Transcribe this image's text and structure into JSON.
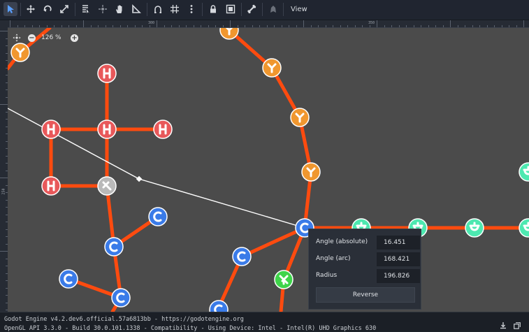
{
  "toolbar": {
    "tools": [
      {
        "name": "select-tool",
        "icon": "arrow-cursor-icon",
        "active": true
      },
      {
        "name": "move-tool",
        "icon": "move-arrows-icon"
      },
      {
        "name": "rotate-tool",
        "icon": "rotate-icon"
      },
      {
        "name": "scale-tool",
        "icon": "scale-icon"
      },
      {
        "name": "list-select-tool",
        "icon": "list-select-icon"
      },
      {
        "name": "pivot-tool",
        "icon": "pivot-icon"
      },
      {
        "name": "pan-tool",
        "icon": "hand-icon"
      },
      {
        "name": "ruler-tool",
        "icon": "ruler-icon"
      },
      {
        "name": "smart-snap-tool",
        "icon": "snap-icon"
      },
      {
        "name": "grid-snap-tool",
        "icon": "grid-snap-icon"
      },
      {
        "name": "snap-options",
        "icon": "kebab-icon"
      },
      {
        "name": "lock-tool",
        "icon": "lock-icon"
      },
      {
        "name": "group-tool",
        "icon": "group-icon"
      },
      {
        "name": "bone-tool",
        "icon": "bone-icon"
      },
      {
        "name": "skeleton-tool",
        "icon": "skeleton-icon"
      }
    ],
    "view_label": "View"
  },
  "rulers": {
    "top_labels": [
      "300",
      "350"
    ],
    "left_labels": [
      "250"
    ]
  },
  "zoom": {
    "value": "126 %",
    "minus_label": "−",
    "plus_label": "+"
  },
  "popup": {
    "rows": [
      {
        "label": "Angle (absolute)",
        "value": "16.451"
      },
      {
        "label": "Angle (arc)",
        "value": "168.421"
      },
      {
        "label": "Radius",
        "value": "196.826"
      }
    ],
    "reverse_label": "Reverse"
  },
  "status": {
    "line1": "Godot Engine v4.2.dev6.official.57a6813bb - https://godotengine.org",
    "line2": "OpenGL API 3.3.0 - Build 30.0.101.1338 - Compatibility - Using Device: Intel - Intel(R) UHD Graphics 630"
  },
  "colors": {
    "viewport_bg": "#4b4b4b",
    "bond": "#ff4b0f",
    "hydrogen": "#e8585a",
    "carbon": "#3a7be8",
    "nitrogen": "#f0972f",
    "teal": "#4de8b0",
    "green": "#3fd44a",
    "grey": "#b9b9b9"
  }
}
